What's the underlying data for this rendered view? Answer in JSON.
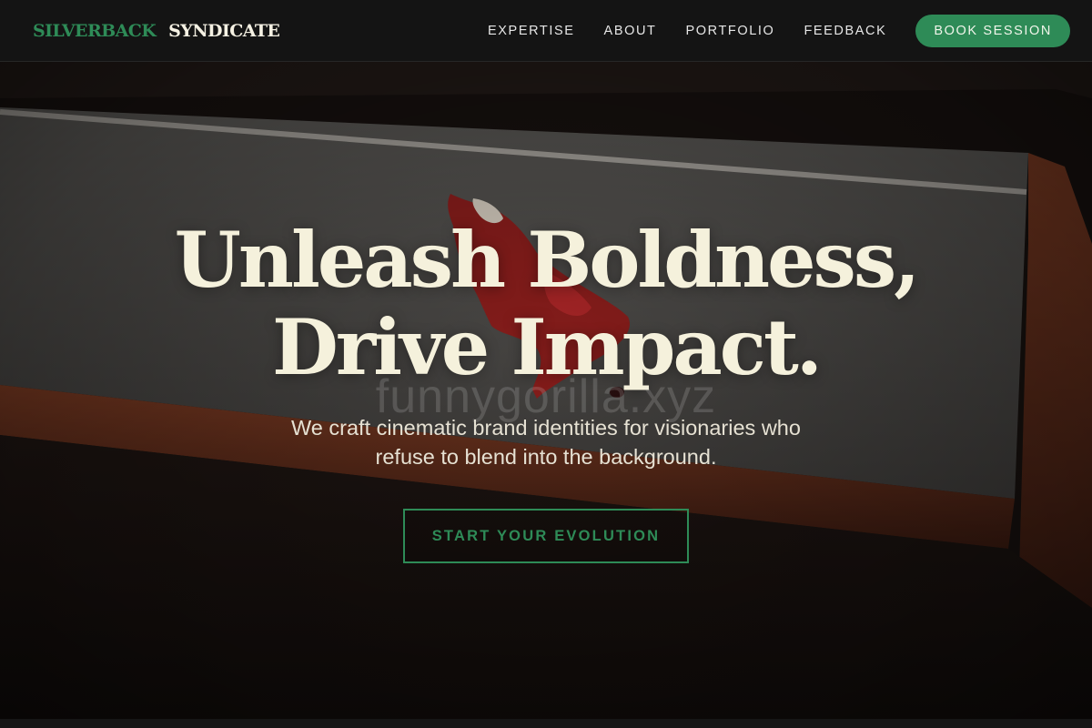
{
  "brand": {
    "part1": "SILVERBACK",
    "part2": "SYNDICATE"
  },
  "nav": {
    "links": [
      {
        "label": "EXPERTISE"
      },
      {
        "label": "ABOUT"
      },
      {
        "label": "PORTFOLIO"
      },
      {
        "label": "FEEDBACK"
      }
    ],
    "cta_label": "BOOK SESSION"
  },
  "hero": {
    "title_line1": "Unleash Boldness,",
    "title_line2": "Drive Impact.",
    "watermark": "funnygorilla.xyz",
    "subtitle_line1": "We craft cinematic brand identities for visionaries who",
    "subtitle_line2": "refuse to blend into the background.",
    "cta_label": "START YOUR EVOLUTION"
  },
  "colors": {
    "accent": "#2e8b57",
    "nav_bg": "#141414",
    "headline": "#f5f1dc"
  }
}
